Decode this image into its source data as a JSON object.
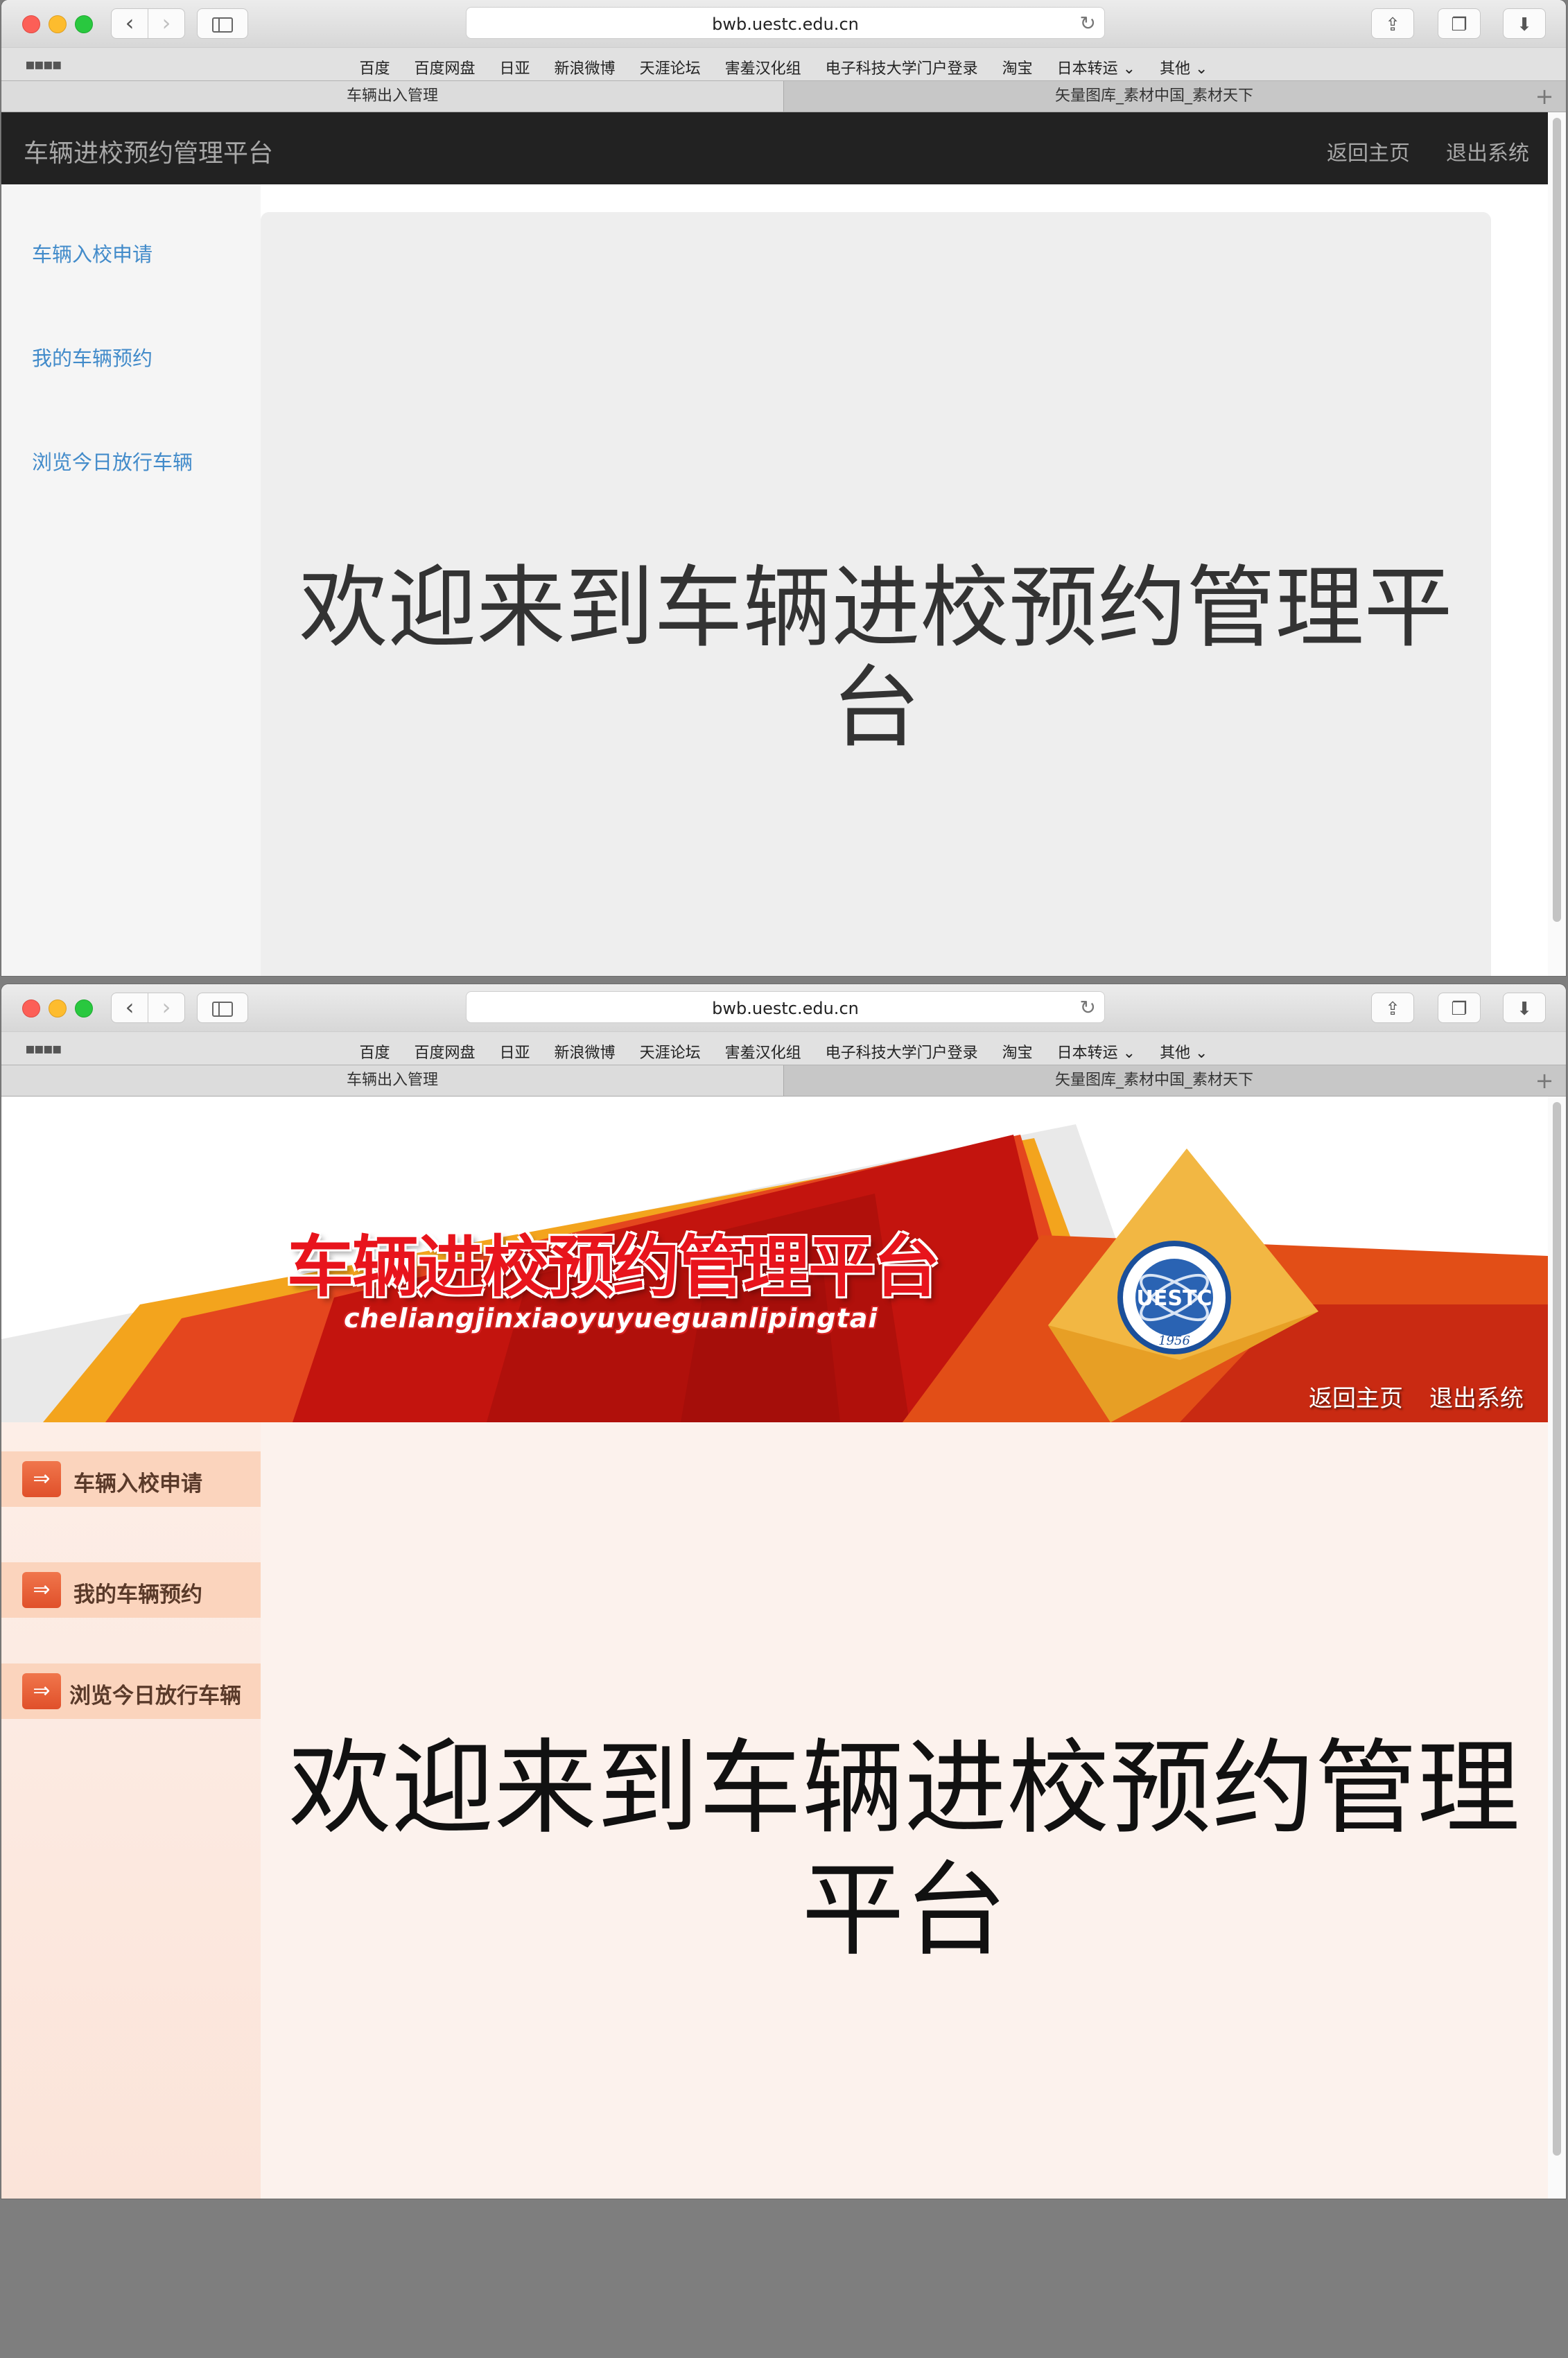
{
  "browser": {
    "url": "bwb.uestc.edu.cn",
    "bookmarks": [
      "百度",
      "百度网盘",
      "日亚",
      "新浪微博",
      "天涯论坛",
      "害羞汉化组",
      "电子科技大学门户登录",
      "淘宝",
      "日本转运 ⌄",
      "其他 ⌄"
    ],
    "tabs": [
      "车辆出入管理",
      "矢量图库_素材中国_素材天下"
    ]
  },
  "window1": {
    "brand": "车辆进校预约管理平台",
    "nav_right": [
      "返回主页",
      "退出系统"
    ],
    "sidebar": [
      "车辆入校申请",
      "我的车辆预约",
      "浏览今日放行车辆"
    ],
    "welcome": "欢迎来到车辆进校预约管理平台"
  },
  "window2": {
    "banner_title": "车辆进校预约管理平台",
    "banner_pinyin": "cheliangjinxiaoyuyueguanlipingtai",
    "emblem_text": "UESTC",
    "emblem_year": "1956",
    "nav_right": [
      "返回主页",
      "退出系统"
    ],
    "sidebar": [
      "车辆入校申请",
      "我的车辆预约",
      "浏览今日放行车辆"
    ],
    "welcome": "欢迎来到车辆进校预约管理平台"
  },
  "colors": {
    "navbar_dark": "#222222",
    "link_blue": "#428bca",
    "banner_red": "#c3140e",
    "banner_orange": "#f39a18",
    "menu_peach": "#fbd4bd"
  }
}
